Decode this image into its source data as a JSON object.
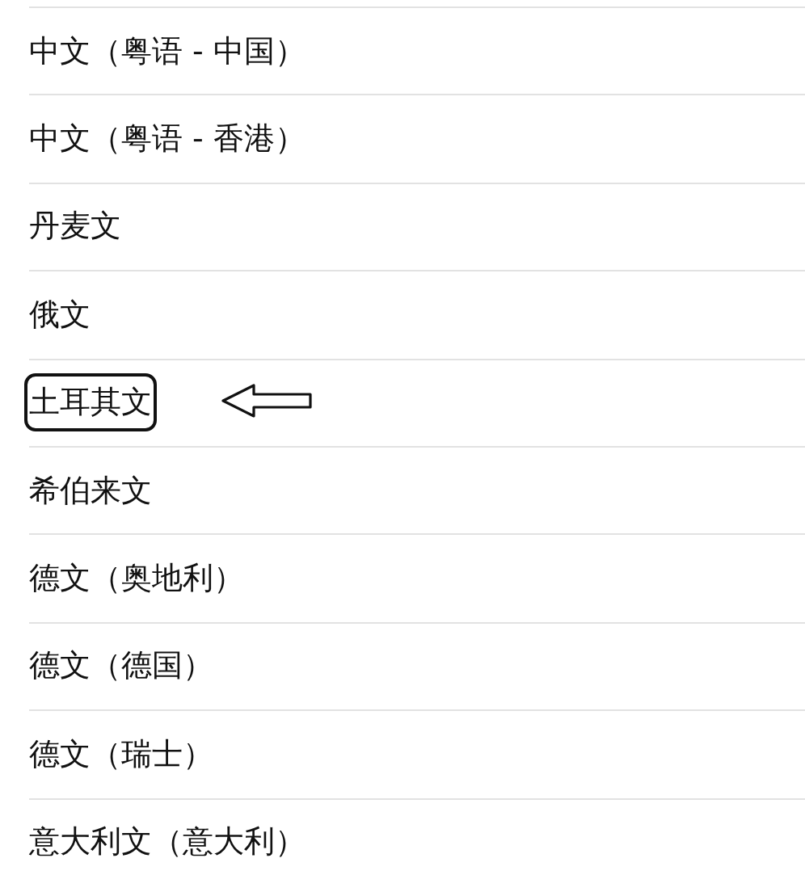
{
  "languages": [
    {
      "label": "中文（粤语 - 中国）",
      "highlighted": false
    },
    {
      "label": "中文（粤语 - 香港）",
      "highlighted": false
    },
    {
      "label": "丹麦文",
      "highlighted": false
    },
    {
      "label": "俄文",
      "highlighted": false
    },
    {
      "label": "土耳其文",
      "highlighted": true
    },
    {
      "label": "希伯来文",
      "highlighted": false
    },
    {
      "label": "德文（奥地利）",
      "highlighted": false
    },
    {
      "label": "德文（德国）",
      "highlighted": false
    },
    {
      "label": "德文（瑞士）",
      "highlighted": false
    },
    {
      "label": "意大利文（意大利）",
      "highlighted": false
    }
  ]
}
